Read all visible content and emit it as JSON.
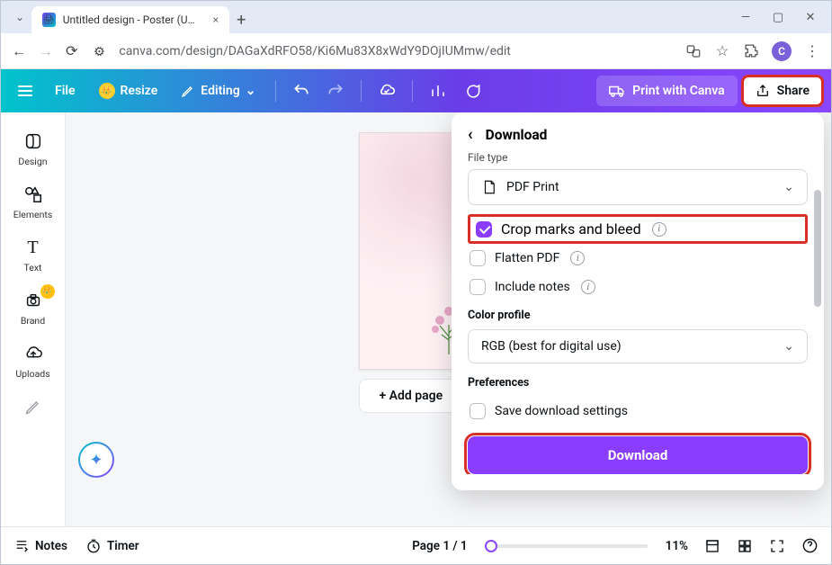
{
  "browser": {
    "tab_title": "Untitled design - Poster (US) - C",
    "url": "canva.com/design/DAGaXdRFO58/Ki6Mu83X8xWdY9DOjIUMmw/edit",
    "avatar_initial": "C"
  },
  "toolbar": {
    "file": "File",
    "resize": "Resize",
    "editing": "Editing",
    "print": "Print with Canva",
    "share": "Share"
  },
  "sidebar": {
    "design": "Design",
    "elements": "Elements",
    "text": "Text",
    "brand": "Brand",
    "uploads": "Uploads"
  },
  "canvas": {
    "add_page": "+ Add page"
  },
  "panel": {
    "title": "Download",
    "file_type_label": "File type",
    "file_type_value": "PDF Print",
    "crop_bleed": "Crop marks and bleed",
    "flatten": "Flatten PDF",
    "include_notes": "Include notes",
    "color_profile_label": "Color profile",
    "color_profile_value": "RGB (best for digital use)",
    "preferences": "Preferences",
    "save_settings": "Save download settings",
    "download_btn": "Download"
  },
  "bottom": {
    "notes": "Notes",
    "timer": "Timer",
    "page": "Page 1 / 1",
    "zoom": "11%"
  }
}
